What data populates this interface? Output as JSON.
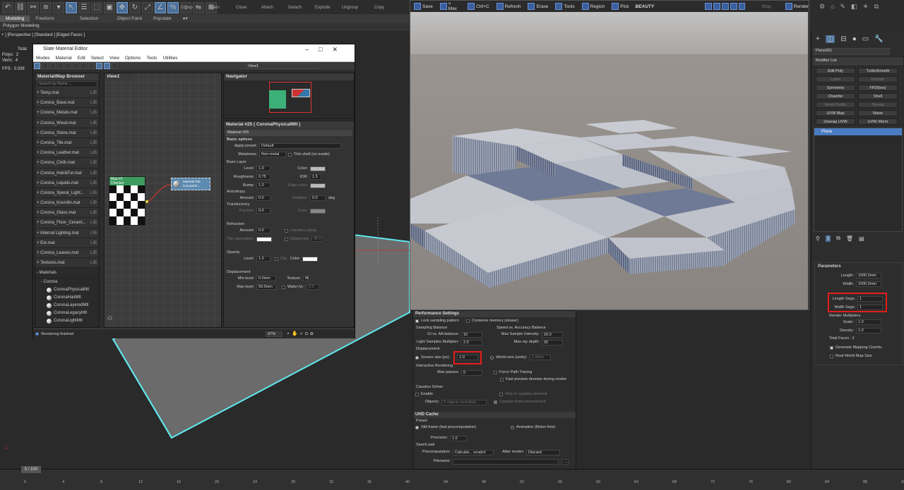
{
  "ribbon": {
    "tabs": [
      "Modeling",
      "Freeform",
      "Selection",
      "Object Paint",
      "Populate"
    ],
    "labels": [
      "Group",
      "Open",
      "Close",
      "Attach",
      "Detach",
      "Explode",
      "Ungroup",
      "Copy"
    ],
    "sub_label": "Polygon Modeling"
  },
  "viewport": {
    "label": "+ ] [Perspective ] [Standard ] [Edged Faces ]",
    "stats_total": "Total",
    "polys_label": "Polys:",
    "polys": "2",
    "verts_label": "Verts:",
    "verts": "4",
    "fps_label": "FPS:",
    "fps": "0.038"
  },
  "sme": {
    "title": "Slate Material Editor",
    "menu": [
      "Modes",
      "Material",
      "Edit",
      "Select",
      "View",
      "Options",
      "Tools",
      "Utilities"
    ],
    "view_dropdown": "View1",
    "browser_title": "Material/Map Browser",
    "search_placeholder": "Search by Name ...",
    "libraries": [
      {
        "name": "+ Temp.mat",
        "tag": "LIB"
      },
      {
        "name": "+ Corona_Base.mat",
        "tag": "LIB"
      },
      {
        "name": "+ Corona_Metals.mat",
        "tag": "LIB"
      },
      {
        "name": "+ Corona_Wood.mat",
        "tag": "LIB"
      },
      {
        "name": "+ Corona_Stone.mat",
        "tag": "LIB"
      },
      {
        "name": "+ Corona_Tile.mat",
        "tag": "LIB"
      },
      {
        "name": "+ Corona_Leather.mat",
        "tag": "LIB"
      },
      {
        "name": "+ Corona_Cloth.mat",
        "tag": "LIB"
      },
      {
        "name": "+ Corona_Hair&Fur.mat",
        "tag": "LIB"
      },
      {
        "name": "+ Corona_Liquids.mat",
        "tag": "LIB"
      },
      {
        "name": "+ Corona_Speral_Light...",
        "tag": "LIB"
      },
      {
        "name": "+ Corona_Kovrolin.mat",
        "tag": "LIB"
      },
      {
        "name": "+ Corona_Glass.mat",
        "tag": "LIB"
      },
      {
        "name": "+ Corona_Floor_Cerami...",
        "tag": "LIB"
      },
      {
        "name": "+ Internal Lighting.mat",
        "tag": "LIB"
      },
      {
        "name": "+ Ext.mat",
        "tag": "LIB"
      },
      {
        "name": "+ Corona_Leaves.mat",
        "tag": "LIB"
      },
      {
        "name": "+ Textures.mat",
        "tag": "LIB"
      }
    ],
    "materials_group": "- Materials",
    "corona_group": "- Corona",
    "corona_items": [
      "CoronaPhysicalMtl",
      "CoronaHairMtl",
      "CoronaLayeredMtl",
      "CoronaLegacyMtl",
      "CoronaLightMtl"
    ],
    "view_tab": "View1",
    "node_map_title": "Map #1",
    "node_map_sub": "Checker",
    "node_mat_title": "Material #25",
    "node_mat_sub": "CoronaPh...",
    "navigator_title": "Navigator",
    "params_title": "Material #25  ( CoronaPhysicalMtl )",
    "mat_name": "Material #25",
    "basic_options": "Basic options",
    "apply_preset_label": "Apply preset:",
    "apply_preset": "Default",
    "metalness_label": "Metalness:",
    "metalness": "Non-metal",
    "thin_shell": "Thin shell (no inside)",
    "base_layer": "Base Layer",
    "level_label": "Level:",
    "level": "1.0",
    "color_label": "Color:",
    "roughness_label": "Roughness:",
    "roughness": "0.75",
    "ior_label": "IOR:",
    "ior": "1.5",
    "bump_label": "Bump:",
    "bump": "1.0",
    "edge_color_label": "Edge color:",
    "anisotropy": "Anisotropy",
    "amount_label": "Amount:",
    "amount": "0.0",
    "rotation_label": "Rotation:",
    "rotation": "0.0",
    "deg": "deg",
    "translucency": "Translucency",
    "fraction_label": "Fraction:",
    "fraction": "0.0",
    "refraction": "Refraction",
    "ref_amount": "0.0",
    "caustics": "Caustics (slow)",
    "thin_absorption": "Thin absorption:",
    "dispersion": "Dispersion",
    "dispersion_val": "40.0",
    "opacity": "Opacity",
    "op_level": "1.0",
    "clip": "Clip",
    "displacement": "Displacement",
    "min_level_label": "Min level:",
    "min_level": "0.0mm",
    "texture_label": "Texture:",
    "texture_val": "M",
    "max_level_label": "Max level:",
    "max_level": "50.0mm",
    "water_lvl_label": "Water lvl.:",
    "water_lvl": "0.5",
    "status": "Rendering finished",
    "zoom": "67%"
  },
  "render": {
    "toolbar": [
      "Save",
      "> Max",
      "Ctrl+C",
      "Refresh",
      "Erase",
      "Tools",
      "Region",
      "Pick"
    ],
    "beauty": "BEAUTY",
    "stop": "Stop",
    "render": "Render",
    "plank_color": "#b3b7c2",
    "bg_color": "#8f8a87",
    "sky_color": "#b8b7b6"
  },
  "settings": {
    "perf_title": "Performance Settings",
    "lock_sampling": "Lock sampling pattern",
    "conserve_memory": "Conserve memory (slower)",
    "sampling_balance": "Sampling Balance",
    "speed_vs_accuracy": "Speed vs. Accuracy Balance",
    "gi_aa_label": "GI vs. AA balance:",
    "gi_aa": "16",
    "max_sample_label": "Max Sample Intensity:",
    "max_sample": "20.0",
    "light_mult_label": "Light Samples Multiplier:",
    "light_mult": "2.0",
    "max_ray_label": "Max ray depth:",
    "max_ray": "25",
    "disp_title": "Displacement",
    "screen_size_label": "Screen size (px):",
    "screen_size": "1.0",
    "world_size_label": "World size (units):",
    "world_size": "1.0mm",
    "interactive": "Interactive Rendering",
    "max_passes_label": "Max passes:",
    "max_passes": "0",
    "force_path": "Force Path Tracing",
    "fast_preview": "Fast preview denoise during render",
    "caustics_solver": "Caustics Solver",
    "enable": "Enable",
    "only_caustics": "Only in caustics element",
    "objects_label": "Objects:",
    "objects": "0 objects excluded...",
    "caustics_env": "Caustics from environment",
    "uhd_title": "UHD Cache",
    "preset_label": "Preset",
    "still_frame": "Still frame (fast precomputation)",
    "animation": "Animation (flicker-free)",
    "precision_label": "Precision:",
    "precision": "1.0",
    "save_load": "Save/Load",
    "precomp_label": "Precomputation:",
    "precomp": "Calculat... scratch",
    "after_render_label": "After render:",
    "after_render": "Discard",
    "filename_label": "Filename:"
  },
  "cmd": {
    "object_name": "Plane001",
    "modifier_list": "Modifier List",
    "modifiers": [
      [
        "Edit Poly",
        "TurboSmooth"
      ],
      [
        "Lathe",
        "Extrude"
      ],
      [
        "Symmetry",
        "FFD(box)"
      ],
      [
        "Chamfer",
        "Shell"
      ],
      [
        "Bevel Profile",
        "Sweep"
      ],
      [
        "UVW Map",
        "Noise"
      ],
      [
        "Unwrap UVW",
        "UVW Xform"
      ]
    ],
    "stack_item": "Plane",
    "parameters": "Parameters",
    "length_label": "Length:",
    "length": "1000.0mm",
    "width_label": "Width:",
    "width": "1000.0mm",
    "length_segs_label": "Length Segs:",
    "length_segs": "1",
    "width_segs_label": "Width Segs:",
    "width_segs": "1",
    "render_mult": "Render Multipliers",
    "scale_label": "Scale:",
    "scale": "1.0",
    "density_label": "Density:",
    "density": "1.0",
    "total_faces": "Total Faces : 2",
    "gen_mapping": "Generate Mapping Coords.",
    "real_world": "Real-World Map Size"
  },
  "timeline": {
    "frame": "0 / 100",
    "ticks": [
      "0",
      "4",
      "8",
      "12",
      "16",
      "20",
      "24",
      "28",
      "32",
      "36",
      "40",
      "44",
      "48",
      "52",
      "56",
      "60",
      "64",
      "68",
      "72",
      "76",
      "80",
      "84",
      "88",
      "92"
    ]
  }
}
